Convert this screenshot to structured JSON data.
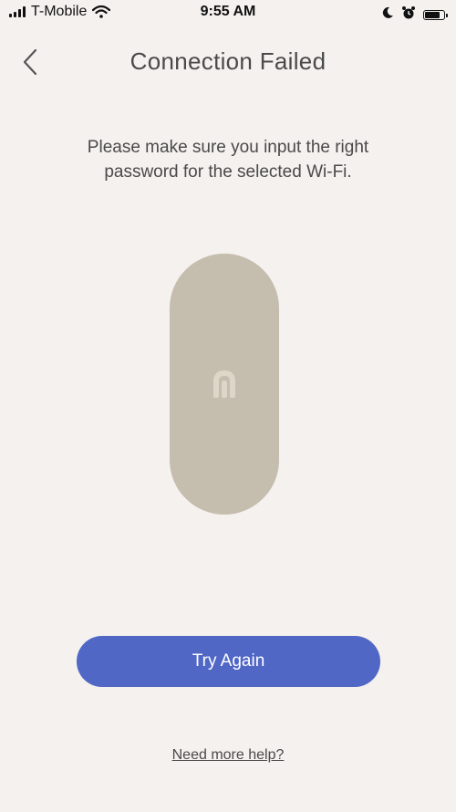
{
  "status_bar": {
    "carrier": "T-Mobile",
    "time": "9:55 AM",
    "icons": [
      "signal-icon",
      "wifi-icon",
      "moon-icon",
      "alarm-icon",
      "battery-icon"
    ]
  },
  "nav": {
    "back_icon": "chevron-left-icon",
    "title": "Connection Failed"
  },
  "main": {
    "message": "Please make sure you input the right password for the selected Wi-Fi.",
    "device_logo_icon": "device-logo-icon",
    "try_again_label": "Try Again",
    "help_link_label": "Need more help?"
  },
  "colors": {
    "background": "#f4f1ee",
    "device": "#c5bdad",
    "primary_button": "#5067c6",
    "text": "#4a4a4a"
  }
}
